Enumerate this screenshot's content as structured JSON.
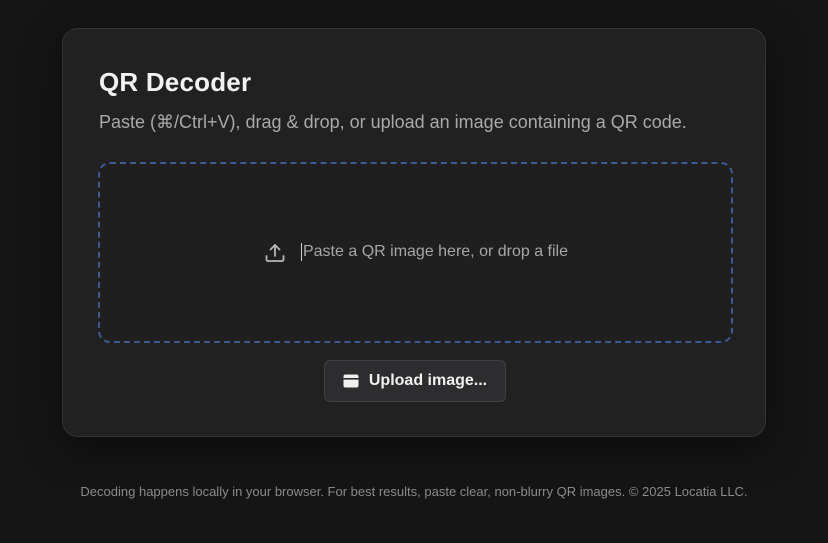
{
  "card": {
    "title": "QR Decoder",
    "subtitle": "Paste (⌘/Ctrl+V), drag & drop, or upload an image containing a QR code."
  },
  "dropzone": {
    "prompt": "Paste a QR image here, or drop a file",
    "icon": "upload-icon",
    "border_color": "#3b5a96"
  },
  "upload_button": {
    "label": "Upload image...",
    "icon": "card-icon"
  },
  "footer": {
    "text": "Decoding happens locally in your browser. For best results, paste clear, non-blurry QR images. © 2025 Locatia LLC."
  }
}
